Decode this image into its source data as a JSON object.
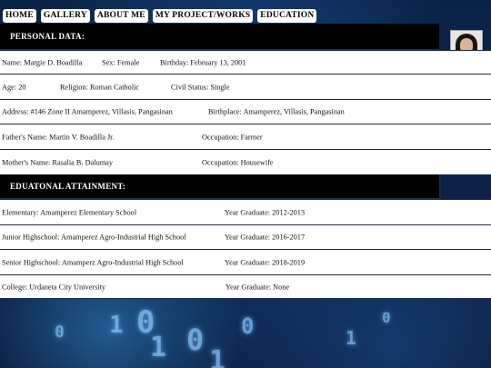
{
  "nav": [
    "HOME",
    "GALLERY",
    "ABOUT ME",
    "MY PROJECT/WORKS",
    "EDUCATION"
  ],
  "personal": {
    "heading": "PERSONAL DATA:",
    "name": "Name: Margie D. Boadilla",
    "sex": "Sex: Female",
    "birthday": "Birthday: February 13, 2001",
    "age": "Age: 20",
    "religion": "Religion: Roman Catholic",
    "civil": "Civil Status: Single",
    "address": "Address: #146 Zone II Amamperez, Villasis, Pangasinan",
    "birthplace": "Birthplace: Amamperez, Villasis, Pangasinan",
    "father": "Father's Name: Martin V. Boadilla Jr.",
    "father_occ": "Occupation: Farmer",
    "mother": "Mother's Name: Rasalia B. Dalumay",
    "mother_occ": "Occupation: Housewife"
  },
  "education": {
    "heading": "EDUATONAL ATTAINMENT:",
    "rows": [
      {
        "school": "Elementary: Amamperez Elementary School",
        "year": "Year Graduate: 2012-2013"
      },
      {
        "school": "Junior Highschool: Amamperez Agro-Industrial High School",
        "year": "Year Graduate: 2016-2017"
      },
      {
        "school": "Senior Highschool: Amamperz Agro-Industrial High School",
        "year": "Year Graduate: 2018-2019"
      },
      {
        "school": "College: Urdaneta City University",
        "year": "Year Graduate: None"
      }
    ]
  },
  "background_digits": [
    "1",
    "0",
    "1",
    "0",
    "1",
    "0",
    "0",
    "1",
    "0"
  ]
}
